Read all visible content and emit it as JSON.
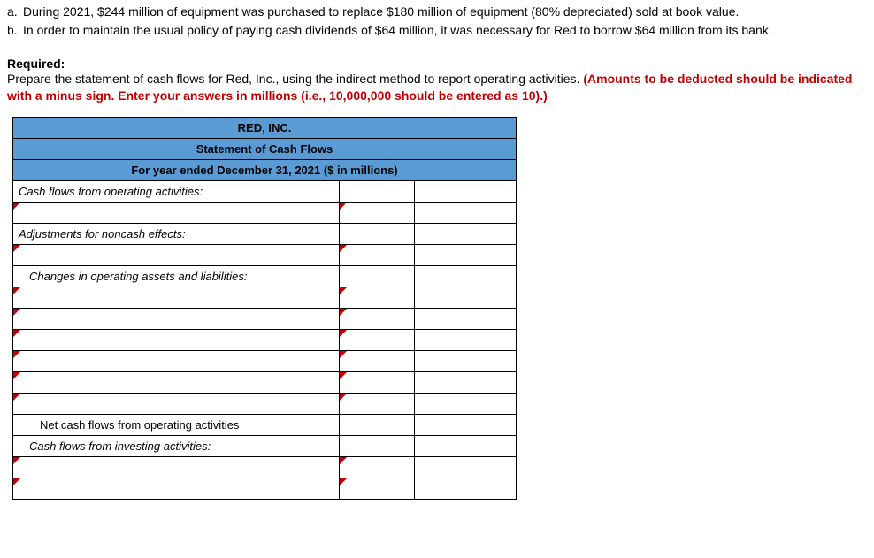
{
  "intro": {
    "items": [
      {
        "marker": "a.",
        "text": "During 2021, $244 million of equipment was purchased to replace $180 million of equipment (80% depreciated) sold at book value."
      },
      {
        "marker": "b.",
        "text": "In order to maintain the usual policy of paying cash dividends of $64 million, it was necessary for Red to borrow $64 million from its bank."
      }
    ]
  },
  "required": {
    "label": "Required:",
    "text_plain": "Prepare the statement of cash flows for Red, Inc., using the indirect method to report operating activities. ",
    "text_red": "(Amounts to be deducted should be indicated with a minus sign. Enter your answers in millions (i.e., 10,000,000 should be entered as 10).)"
  },
  "sheet": {
    "title": "RED, INC.",
    "subtitle": "Statement of Cash Flows",
    "period": "For year ended December 31, 2021 ($ in millions)",
    "rows": {
      "op_header": "Cash flows from operating activities:",
      "adj_header": "Adjustments for noncash effects:",
      "changes_header": "Changes in operating assets and liabilities:",
      "net_op": "Net cash flows from operating activities",
      "inv_header": "Cash flows from investing activities:"
    }
  }
}
